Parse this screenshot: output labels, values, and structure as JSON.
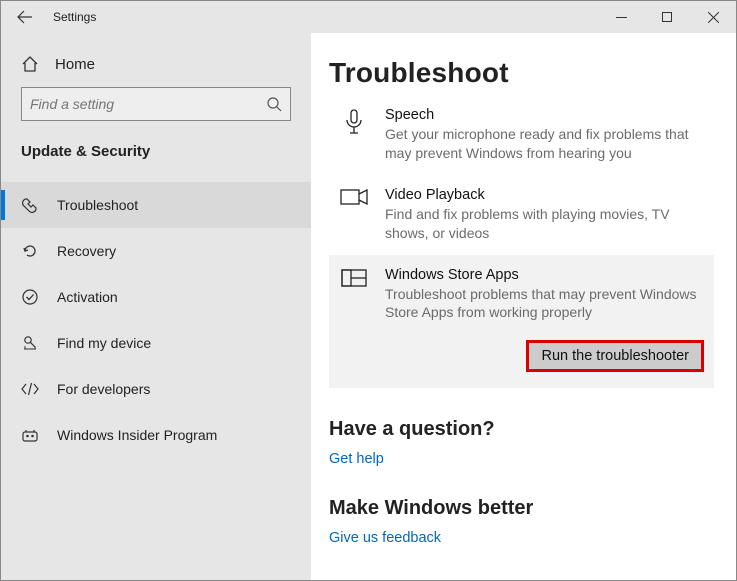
{
  "window": {
    "title": "Settings"
  },
  "sidebar": {
    "home_label": "Home",
    "search_placeholder": "Find a setting",
    "section": "Update & Security",
    "items": [
      {
        "label": "Troubleshoot"
      },
      {
        "label": "Recovery"
      },
      {
        "label": "Activation"
      },
      {
        "label": "Find my device"
      },
      {
        "label": "For developers"
      },
      {
        "label": "Windows Insider Program"
      }
    ]
  },
  "main": {
    "title": "Troubleshoot",
    "items": [
      {
        "name": "Speech",
        "desc": "Get your microphone ready and fix problems that may prevent Windows from hearing you"
      },
      {
        "name": "Video Playback",
        "desc": "Find and fix problems with playing movies, TV shows, or videos"
      },
      {
        "name": "Windows Store Apps",
        "desc": "Troubleshoot problems that may prevent Windows Store Apps from working properly"
      }
    ],
    "run_label": "Run the troubleshooter",
    "question": {
      "heading": "Have a question?",
      "link": "Get help"
    },
    "feedback": {
      "heading": "Make Windows better",
      "link": "Give us feedback"
    }
  }
}
